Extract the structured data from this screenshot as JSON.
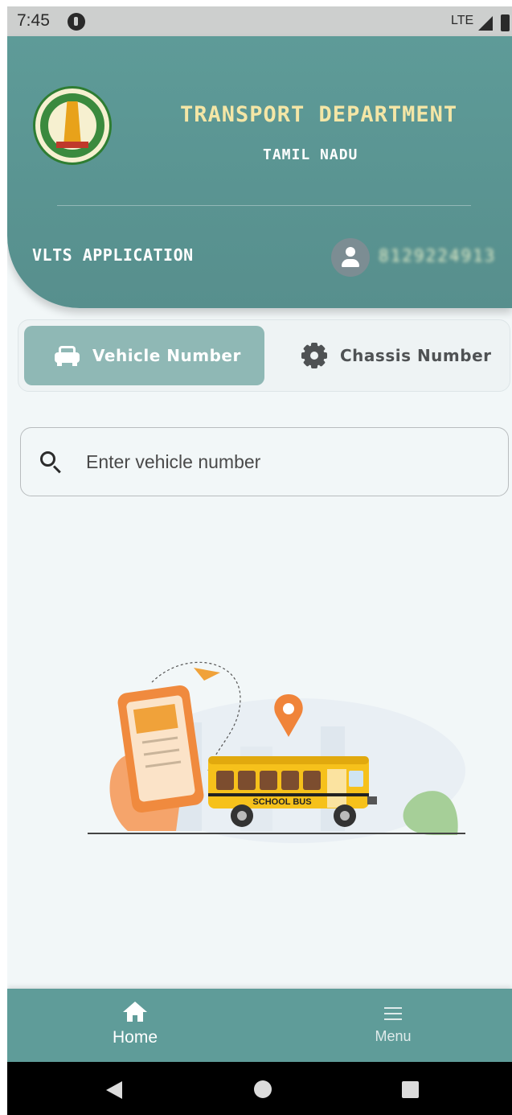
{
  "status_bar": {
    "time": "7:45",
    "network": "LTE"
  },
  "header": {
    "title": "TRANSPORT DEPARTMENT",
    "subtitle": "TAMIL NADU",
    "app_label": "VLTS APPLICATION",
    "phone": "8129224913",
    "colors": {
      "header_bg": "#5e9b98",
      "title": "#f4e6a6"
    }
  },
  "tabs": [
    {
      "label": "Vehicle Number",
      "icon": "car-icon",
      "selected": true
    },
    {
      "label": "Chassis Number",
      "icon": "gear-icon",
      "selected": false
    }
  ],
  "search": {
    "placeholder": "Enter vehicle number",
    "value": ""
  },
  "illustration": {
    "bus_text": "SCHOOL BUS"
  },
  "bottom_nav": {
    "items": [
      {
        "label": "Home",
        "icon": "home-icon",
        "active": true
      },
      {
        "label": "Menu",
        "icon": "menu-icon",
        "active": false
      }
    ],
    "color": "#5f9c99"
  }
}
